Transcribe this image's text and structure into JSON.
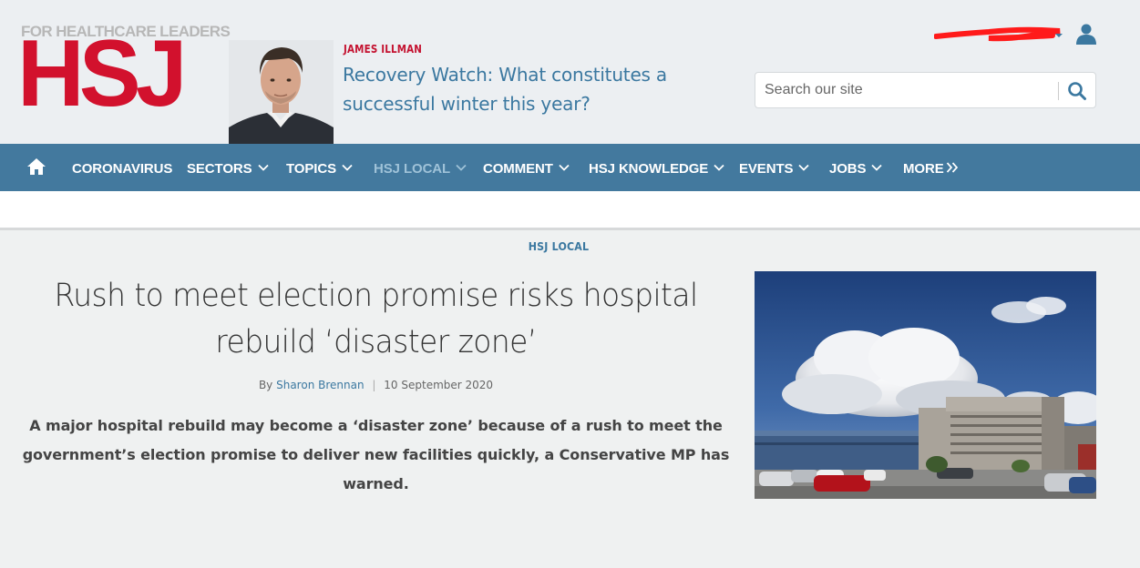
{
  "header": {
    "logo": {
      "tagline": "FOR HEALTHCARE LEADERS",
      "wordmark": "HSJ"
    },
    "featured": {
      "author": "JAMES ILLMAN",
      "headline": "Recovery Watch: What constitutes a successful winter this year?"
    },
    "user_icon": "user-icon",
    "search": {
      "placeholder": "Search our site",
      "icon": "search-icon"
    }
  },
  "nav": {
    "home_icon": "home-icon",
    "items": [
      {
        "label": "CORONAVIRUS"
      },
      {
        "label": "SECTORS"
      },
      {
        "label": "TOPICS"
      },
      {
        "label": "HSJ LOCAL"
      },
      {
        "label": "COMMENT"
      },
      {
        "label": "HSJ KNOWLEDGE"
      },
      {
        "label": "EVENTS"
      },
      {
        "label": "JOBS"
      },
      {
        "label": "MORE"
      }
    ]
  },
  "article": {
    "section": "HSJ LOCAL",
    "title": "Rush to meet election promise risks hospital rebuild ‘disaster zone’",
    "byline_prefix": "By",
    "byline_author": "Sharon Brennan",
    "byline_separator": "|",
    "date": "10 September 2020",
    "standfirst": "A major hospital rebuild may become a ‘disaster zone’ because of a rush to meet the government’s election promise to deliver new facilities quickly, a Conservative MP has warned."
  },
  "colors": {
    "brand_red": "#d2112d",
    "nav_blue": "#43799e",
    "link_blue": "#3b78a0",
    "background": "#eff1f1"
  }
}
